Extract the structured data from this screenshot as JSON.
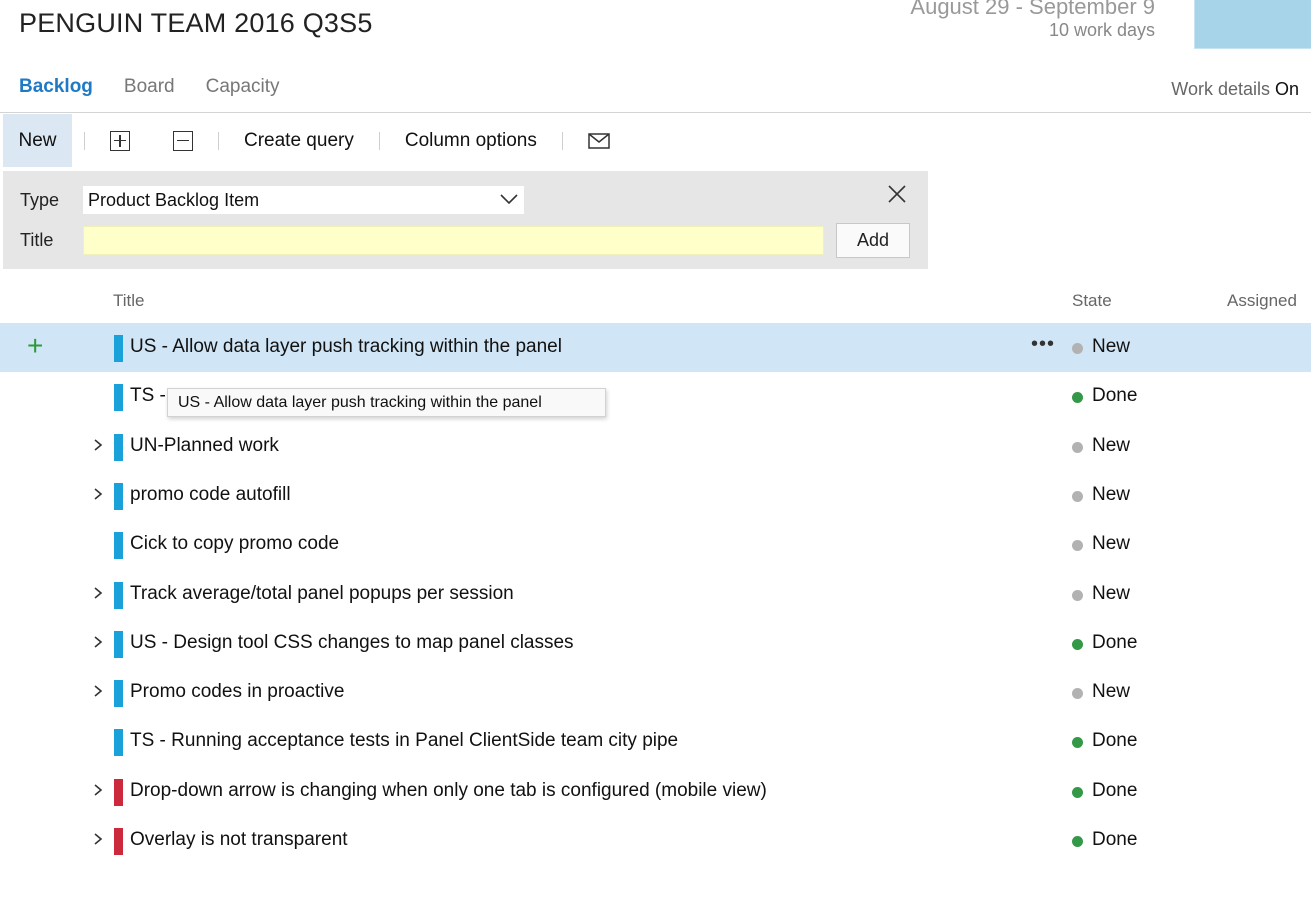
{
  "header": {
    "team_sprint": "PENGUIN TEAM 2016 Q3S5",
    "date_range": "August 29 - September 9",
    "work_days": "10 work days"
  },
  "tabs": [
    {
      "label": "Backlog",
      "active": true
    },
    {
      "label": "Board",
      "active": false
    },
    {
      "label": "Capacity",
      "active": false
    }
  ],
  "work_details": {
    "label": "Work details",
    "value": "On"
  },
  "toolbar": {
    "new_label": "New",
    "expand_icon": "plus-box-icon",
    "collapse_icon": "minus-box-icon",
    "create_query_label": "Create query",
    "column_options_label": "Column options",
    "email_icon": "mail-icon"
  },
  "add_panel": {
    "type_label": "Type",
    "type_value": "Product Backlog Item",
    "title_label": "Title",
    "title_value": "",
    "add_label": "Add"
  },
  "columns": {
    "title": "Title",
    "state": "State",
    "assigned": "Assigned"
  },
  "colors": {
    "accent": "#1f7ac5",
    "selected_row": "#d0e5f5",
    "pbi_bar": "#1ba1d9",
    "bug_bar": "#cc293d",
    "state_new": "#b2b2b2",
    "state_done": "#339947",
    "add_plus": "#2c9a3b"
  },
  "rows": [
    {
      "title": "US - Allow data layer push tracking within the panel",
      "state": "New",
      "kind": "pbi",
      "expandable": false,
      "selected": true
    },
    {
      "title": "TS - ",
      "state": "Done",
      "kind": "pbi",
      "expandable": false,
      "selected": false
    },
    {
      "title": "UN-Planned work",
      "state": "New",
      "kind": "pbi",
      "expandable": true,
      "selected": false
    },
    {
      "title": "promo code autofill",
      "state": "New",
      "kind": "pbi",
      "expandable": true,
      "selected": false
    },
    {
      "title": "Cick to copy promo code",
      "state": "New",
      "kind": "pbi",
      "expandable": false,
      "selected": false
    },
    {
      "title": "Track average/total panel popups per session",
      "state": "New",
      "kind": "pbi",
      "expandable": true,
      "selected": false
    },
    {
      "title": "US - Design tool CSS changes to map panel classes",
      "state": "Done",
      "kind": "pbi",
      "expandable": true,
      "selected": false
    },
    {
      "title": "Promo codes in proactive",
      "state": "New",
      "kind": "pbi",
      "expandable": true,
      "selected": false
    },
    {
      "title": "TS - Running acceptance tests in Panel ClientSide team city pipe",
      "state": "Done",
      "kind": "pbi",
      "expandable": false,
      "selected": false
    },
    {
      "title": "Drop-down arrow is changing when only one tab is configured (mobile view)",
      "state": "Done",
      "kind": "bug",
      "expandable": true,
      "selected": false
    },
    {
      "title": "Overlay is not transparent",
      "state": "Done",
      "kind": "bug",
      "expandable": true,
      "selected": false
    }
  ],
  "tooltip": "US - Allow data layer push tracking within the panel",
  "row_actions": {
    "more": "•••",
    "add": "+"
  }
}
